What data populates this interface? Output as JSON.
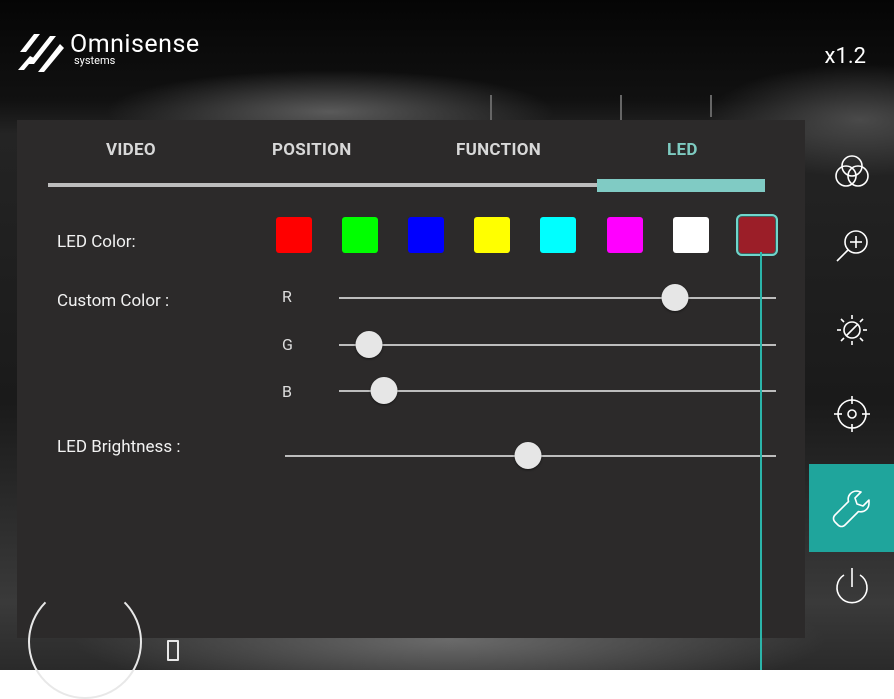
{
  "app": {
    "logo_name": "Omnisense",
    "logo_sub": "systems",
    "zoom": "x1.2"
  },
  "tabs": [
    {
      "label": "VIDEO",
      "active": false
    },
    {
      "label": "POSITION",
      "active": false
    },
    {
      "label": "FUNCTION",
      "active": false
    },
    {
      "label": "LED",
      "active": true
    }
  ],
  "led": {
    "color_label": "LED Color:",
    "custom_label": "Custom Color :",
    "brightness_label": "LED Brightness :",
    "swatches": [
      {
        "name": "red",
        "color": "#ff0000"
      },
      {
        "name": "green",
        "color": "#00ff00"
      },
      {
        "name": "blue",
        "color": "#0000ff"
      },
      {
        "name": "yellow",
        "color": "#ffff00"
      },
      {
        "name": "cyan",
        "color": "#00ffff"
      },
      {
        "name": "magenta",
        "color": "#ff00ff"
      },
      {
        "name": "white",
        "color": "#ffffff"
      },
      {
        "name": "custom",
        "color": "#9b1e28",
        "selected": true
      }
    ],
    "channels": [
      {
        "label": "R",
        "value_fraction": 0.769
      },
      {
        "label": "G",
        "value_fraction": 0.069
      },
      {
        "label": "B",
        "value_fraction": 0.103
      }
    ],
    "brightness_fraction": 0.495
  },
  "sidebar": [
    {
      "icon": "color-circles-icon",
      "active": false
    },
    {
      "icon": "zoom-in-icon",
      "active": false
    },
    {
      "icon": "brightness-icon",
      "active": false
    },
    {
      "icon": "crosshair-icon",
      "active": false
    },
    {
      "icon": "wrench-icon",
      "active": true
    },
    {
      "icon": "power-icon",
      "active": false
    }
  ],
  "colors": {
    "accent": "#80cbc4",
    "active_button": "#1fa59c",
    "panel": "#2c2a2a"
  }
}
